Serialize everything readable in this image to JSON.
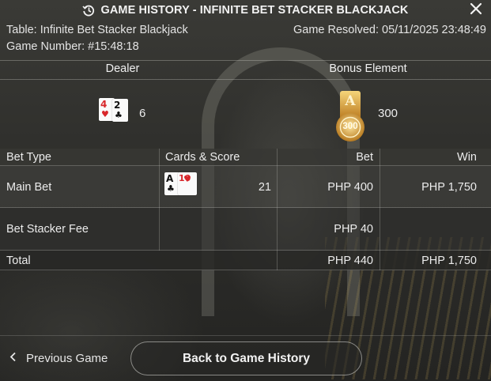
{
  "title": "GAME HISTORY - INFINITE BET STACKER BLACKJACK",
  "table_label": "Table: Infinite Bet Stacker Blackjack",
  "game_number_label": "Game Number: #15:48:18",
  "game_resolved_label": "Game Resolved: 05/11/2025 23:48:49",
  "dealer": {
    "heading": "Dealer",
    "cards": [
      {
        "rank": "4",
        "suit": "♥",
        "color": "#d8262a"
      },
      {
        "rank": "2",
        "suit": "♣",
        "color": "#111111"
      }
    ],
    "score": "6"
  },
  "bonus": {
    "heading": "Bonus Element",
    "chip_letter": "A",
    "chip_value": "300",
    "value": "300"
  },
  "bets": {
    "headers": [
      "Bet Type",
      "Cards & Score",
      "Bet",
      "Win"
    ],
    "main": {
      "type": "Main Bet",
      "cards": [
        {
          "rank": "A",
          "suit": "♣",
          "color": "#111111"
        },
        {
          "rank": "10",
          "suit": "♥",
          "color": "#d8262a"
        }
      ],
      "score": "21",
      "bet": "PHP 400",
      "win": "PHP 1,750"
    },
    "fee": {
      "type": "Bet Stacker Fee",
      "bet": "PHP 40",
      "win": ""
    },
    "total": {
      "type": "Total",
      "bet": "PHP 440",
      "win": "PHP 1,750"
    }
  },
  "footer": {
    "prev_label": "Previous Game",
    "back_label": "Back to Game History"
  },
  "colors": {
    "accent_gold": "#d9a53a",
    "card_red": "#d8262a"
  }
}
